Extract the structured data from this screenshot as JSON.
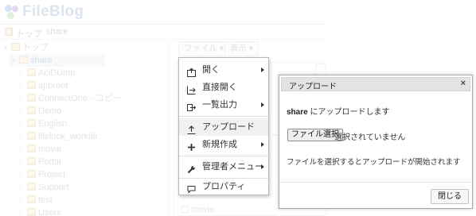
{
  "app": {
    "brand": "FileBlog"
  },
  "breadcrumb": {
    "home": "トップ",
    "separator": "›",
    "current": "share"
  },
  "tree": {
    "root": "トップ",
    "selected": "share",
    "children": [
      "AclDUmp",
      "approot",
      "ConnectOne - コピー",
      "Demo",
      "English",
      "filelock_workdir",
      "movie",
      "Portal",
      "Project",
      "Support",
      "test",
      "Users"
    ]
  },
  "toolbar": {
    "file_label": "ファイル ▾",
    "view_label": "表示 ▾"
  },
  "file_list": {
    "row_name": "movie",
    "fragment_text": "ー"
  },
  "file_menu": {
    "items": [
      {
        "label": "開く",
        "icon": "open-icon",
        "submenu": true
      },
      {
        "label": "直接開く",
        "icon": "direct-open-icon",
        "submenu": false
      },
      {
        "label": "一覧出力",
        "icon": "export-icon",
        "submenu": true
      },
      {
        "label": "アップロード",
        "icon": "upload-icon",
        "submenu": false
      },
      {
        "label": "新規作成",
        "icon": "plus-icon",
        "submenu": true
      },
      {
        "label": "管理者メニュー",
        "icon": "wrench-icon",
        "submenu": true
      },
      {
        "label": "プロパティ",
        "icon": "properties-icon",
        "submenu": false
      }
    ],
    "hovered_item": "アップロード"
  },
  "upload_dialog": {
    "title": "アップロード",
    "close_symbol": "×",
    "target_folder": "share",
    "target_suffix": " にアップロードします",
    "file_button": "ファイル選択",
    "file_status": "選択されていません",
    "info": "ファイルを選択するとアップロードが開始されます",
    "close_button": "閉じる"
  },
  "colors": {
    "menu_border": "#b9b9b9",
    "dialog_header": "#e3e3e3",
    "brand": "#b2c5d8"
  }
}
